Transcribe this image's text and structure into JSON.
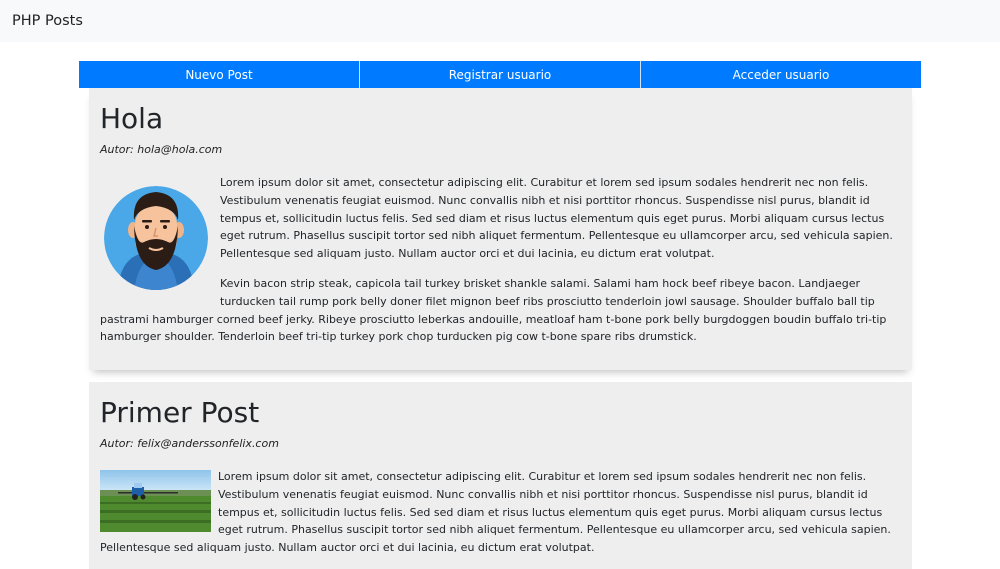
{
  "navbar": {
    "brand": "PHP Posts"
  },
  "nav_buttons": {
    "new_post": "Nuevo Post",
    "register": "Registrar usuario",
    "login": "Acceder usuario"
  },
  "posts": [
    {
      "title": "Hola",
      "author": "Autor: hola@hola.com",
      "image": "bearded-man-avatar",
      "paragraphs": [
        "Lorem ipsum dolor sit amet, consectetur adipiscing elit. Curabitur et lorem sed ipsum sodales hendrerit nec non felis. Vestibulum venenatis feugiat euismod. Nunc convallis nibh et nisi porttitor rhoncus. Suspendisse nisl purus, blandit id tempus et, sollicitudin luctus felis. Sed sed diam et risus luctus elementum quis eget purus. Morbi aliquam cursus lectus eget rutrum. Phasellus suscipit tortor sed nibh aliquet fermentum. Pellentesque eu ullamcorper arcu, sed vehicula sapien. Pellentesque sed aliquam justo. Nullam auctor orci et dui lacinia, eu dictum erat volutpat.",
        "Kevin bacon strip steak, capicola tail turkey brisket shankle salami. Salami ham hock beef ribeye bacon. Landjaeger turducken tail rump pork belly doner filet mignon beef ribs prosciutto tenderloin jowl sausage. Shoulder buffalo ball tip pastrami hamburger corned beef jerky. Ribeye prosciutto leberkas andouille, meatloaf ham t-bone pork belly burgdoggen boudin buffalo tri-tip hamburger shoulder. Tenderloin beef tri-tip turkey pork chop turducken pig cow t-bone spare ribs drumstick."
      ]
    },
    {
      "title": "Primer Post",
      "author": "Autor: felix@anderssonfelix.com",
      "image": "tractor-field-photo",
      "paragraphs": [
        "Lorem ipsum dolor sit amet, consectetur adipiscing elit. Curabitur et lorem sed ipsum sodales hendrerit nec non felis. Vestibulum venenatis feugiat euismod. Nunc convallis nibh et nisi porttitor rhoncus. Suspendisse nisl purus, blandit id tempus et, sollicitudin luctus felis. Sed sed diam et risus luctus elementum quis eget purus. Morbi aliquam cursus lectus eget rutrum. Phasellus suscipit tortor sed nibh aliquet fermentum. Pellentesque eu ullamcorper arcu, sed vehicula sapien. Pellentesque sed aliquam justo. Nullam auctor orci et dui lacinia, eu dictum erat volutpat."
      ]
    }
  ],
  "colors": {
    "primary": "#007bff",
    "card_bg": "#eeeeee",
    "navbar_bg": "#f8f9fa"
  }
}
